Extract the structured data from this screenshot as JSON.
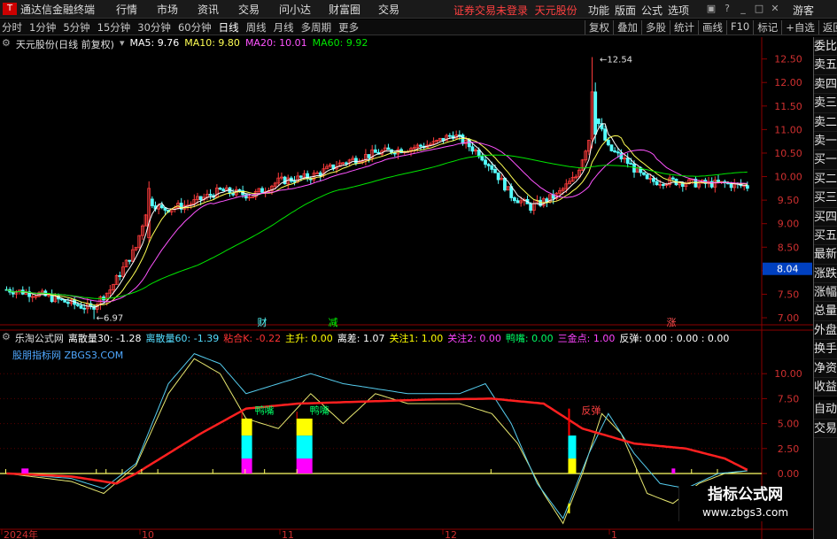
{
  "window": {
    "app_title": "通达信金融终端",
    "menu": [
      "行情",
      "市场",
      "资讯",
      "交易",
      "问小达",
      "财富圈",
      "交易"
    ],
    "warning": "证券交易未登录",
    "stock_short": "天元股份",
    "right_menu": [
      "功能",
      "版面",
      "公式",
      "选项"
    ],
    "guest": "游客"
  },
  "toolbar": {
    "periods": [
      "分时",
      "1分钟",
      "5分钟",
      "15分钟",
      "30分钟",
      "60分钟",
      "日线",
      "周线",
      "月线",
      "多周期",
      "更多"
    ],
    "active_period": "日线",
    "tools": [
      "复权",
      "叠加",
      "多股",
      "统计",
      "画线",
      "F10",
      "标记",
      "+自选",
      "返回"
    ]
  },
  "main_info": {
    "title": "天元股份(日线 前复权)",
    "ma5": "MA5: 9.76",
    "ma10": "MA10: 9.80",
    "ma20": "MA20: 10.01",
    "ma60": "MA60: 9.92",
    "high_label": "12.54",
    "low_label": "6.97",
    "current_price": "8.04",
    "y_ticks": [
      "12.50",
      "12.00",
      "11.50",
      "11.00",
      "10.50",
      "10.00",
      "9.50",
      "9.00",
      "8.50",
      "8.00",
      "7.50",
      "7.00"
    ],
    "event_markers": [
      "财",
      "减",
      "涨"
    ]
  },
  "indicator": {
    "name": "乐淘公式网",
    "lines": [
      {
        "label": "离散量30: -1.28",
        "color": "#ffffff"
      },
      {
        "label": "离散量60: -1.39",
        "color": "#55ddff"
      },
      {
        "label": "粘合K: -0.22",
        "color": "#ff3333"
      },
      {
        "label": "主升: 0.00",
        "color": "#ffff00"
      },
      {
        "label": "离差: 1.07",
        "color": "#ffffff"
      },
      {
        "label": "关注1: 1.00",
        "color": "#ffff00"
      },
      {
        "label": "关注2: 0.00",
        "color": "#ff44ff"
      },
      {
        "label": "鸭嘴: 0.00",
        "color": "#00ff66"
      },
      {
        "label": "三金点: 1.00",
        "color": "#ff44ff"
      },
      {
        "label": "反弹: 0.00 : 0.00 : 0.00",
        "color": "#ffffff"
      }
    ],
    "site": "股朋指标网 ZBGS3.COM",
    "y_ticks": [
      "10.00",
      "7.50",
      "5.00",
      "2.50",
      "0.00"
    ],
    "signals": [
      "鸭嘴",
      "鸭嘴",
      "反弹"
    ]
  },
  "x_axis": [
    "2024年",
    "10",
    "11",
    "12",
    "1"
  ],
  "sidebar": [
    "委比",
    "卖五",
    "卖四",
    "卖三",
    "卖二",
    "卖一",
    "买一",
    "买二",
    "买三",
    "买四",
    "买五",
    "最新",
    "涨跌",
    "涨幅",
    "总量",
    "外盘",
    "换手",
    "净资",
    "收益",
    "自动",
    "交易"
  ],
  "badge": {
    "title": "指标公式网",
    "url": "www.zbgs3.com"
  },
  "colors": {
    "up": "#ff3c3c",
    "down": "#54ffff",
    "ma5": "#ffffff",
    "ma10": "#ffff54",
    "ma20": "#ff54ff",
    "ma60": "#00e600"
  }
}
